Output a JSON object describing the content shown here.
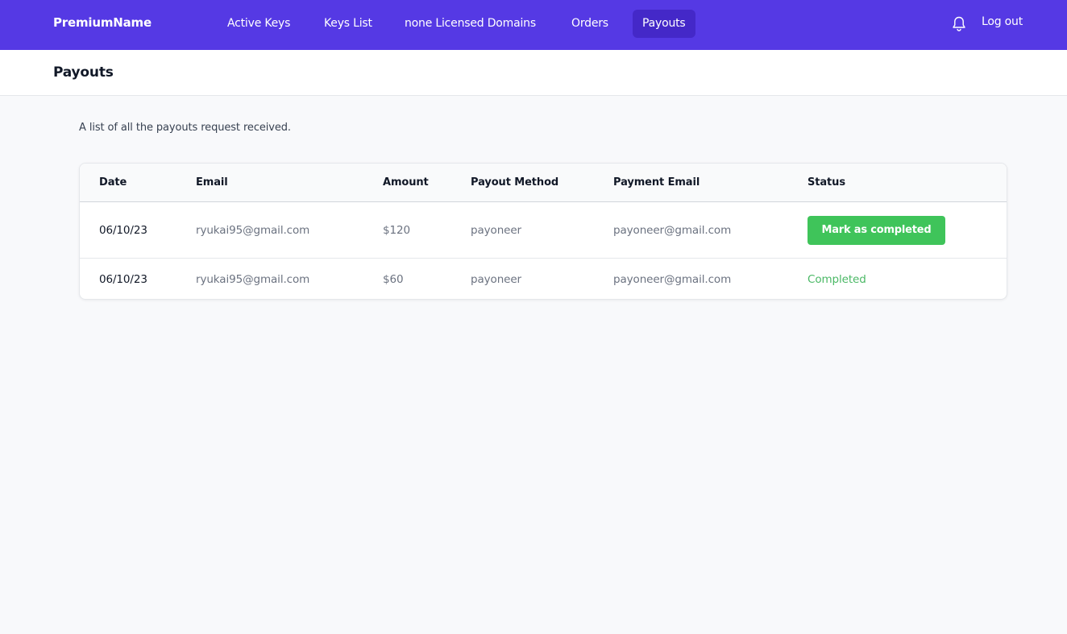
{
  "brand": "PremiumName",
  "nav": {
    "items": [
      {
        "label": "Active Keys"
      },
      {
        "label": "Keys List"
      },
      {
        "label": "none Licensed Domains"
      },
      {
        "label": "Orders"
      },
      {
        "label": "Payouts"
      }
    ],
    "active": "Payouts",
    "logout_label": "Log out"
  },
  "header": {
    "title": "Payouts"
  },
  "description": "A list of all the payouts request received.",
  "table": {
    "columns": [
      "Date",
      "Email",
      "Amount",
      "Payout Method",
      "Payment Email",
      "Status"
    ],
    "rows": [
      {
        "date": "06/10/23",
        "email": "ryukai95@gmail.com",
        "amount": "$120",
        "method": "payoneer",
        "payment_email": "payoneer@gmail.com",
        "status": "Mark as completed"
      },
      {
        "date": "06/10/23",
        "email": "ryukai95@gmail.com",
        "amount": "$60",
        "method": "payoneer",
        "payment_email": "payoneer@gmail.com",
        "status": "Completed"
      }
    ]
  },
  "colors": {
    "nav_bg": "#5539e4",
    "nav_active_bg": "#4428c8",
    "button_green": "#3fc45a",
    "completed_text": "#4ab865"
  },
  "icons": {
    "notifications": "bell-icon"
  }
}
